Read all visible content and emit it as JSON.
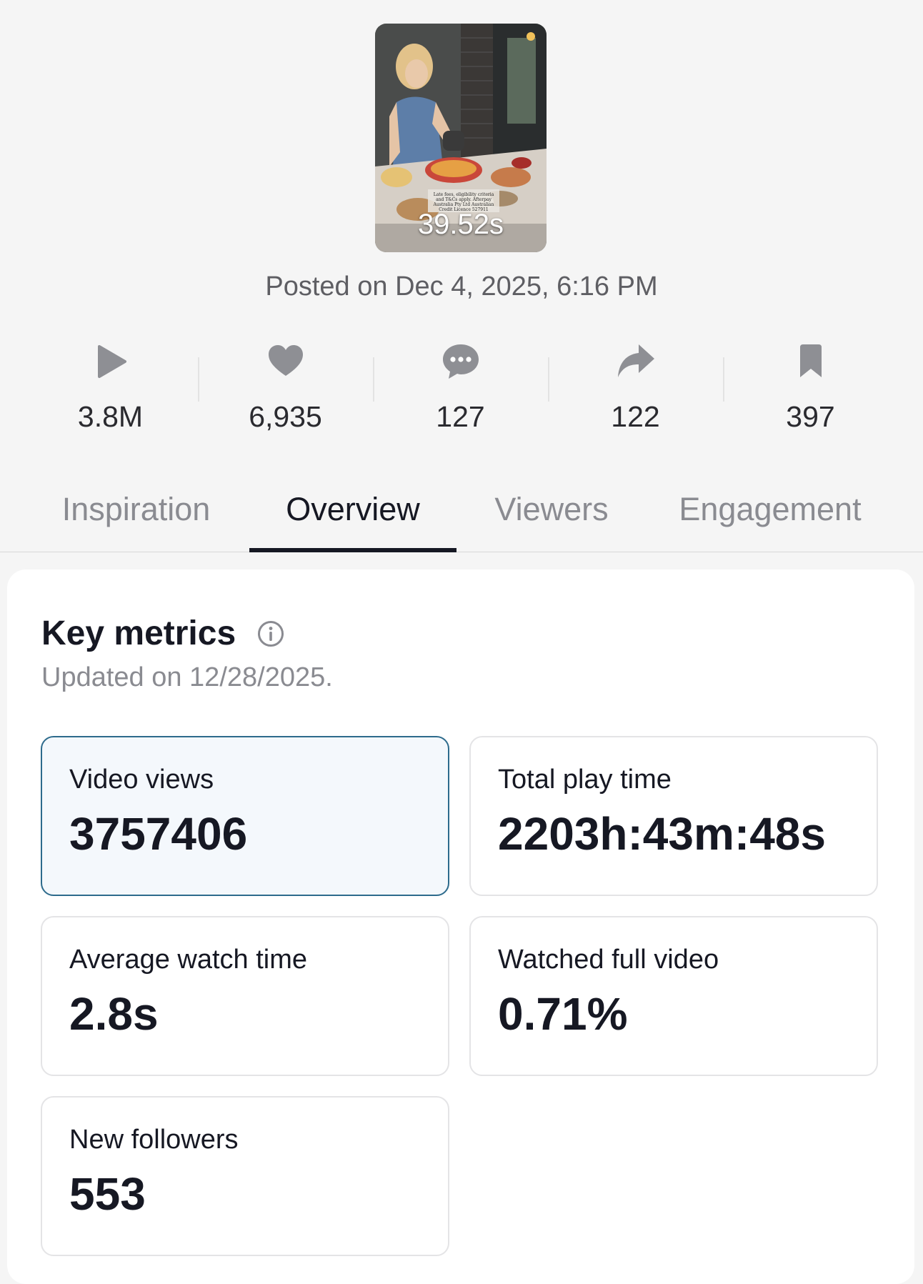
{
  "video": {
    "duration": "39.52s",
    "caption": "Late fees, eligibility criteria and T&Cs apply. Afterpay Australia Pty Ltd Australian Credit Licence 527911",
    "posted": "Posted on Dec 4, 2025, 6:16 PM"
  },
  "stats": [
    {
      "icon": "play-icon",
      "value": "3.8M"
    },
    {
      "icon": "heart-icon",
      "value": "6,935"
    },
    {
      "icon": "comment-icon",
      "value": "127"
    },
    {
      "icon": "share-icon",
      "value": "122"
    },
    {
      "icon": "bookmark-icon",
      "value": "397"
    }
  ],
  "tabs": [
    {
      "label": "Inspiration",
      "active": false
    },
    {
      "label": "Overview",
      "active": true
    },
    {
      "label": "Viewers",
      "active": false
    },
    {
      "label": "Engagement",
      "active": false
    }
  ],
  "key_metrics": {
    "title": "Key metrics",
    "updated": "Updated on 12/28/2025.",
    "cards": [
      {
        "label": "Video views",
        "value": "3757406",
        "selected": true
      },
      {
        "label": "Total play time",
        "value": "2203h:43m:48s",
        "selected": false
      },
      {
        "label": "Average watch time",
        "value": "2.8s",
        "selected": false
      },
      {
        "label": "Watched full video",
        "value": "0.71%",
        "selected": false
      },
      {
        "label": "New followers",
        "value": "553",
        "selected": false
      }
    ]
  }
}
